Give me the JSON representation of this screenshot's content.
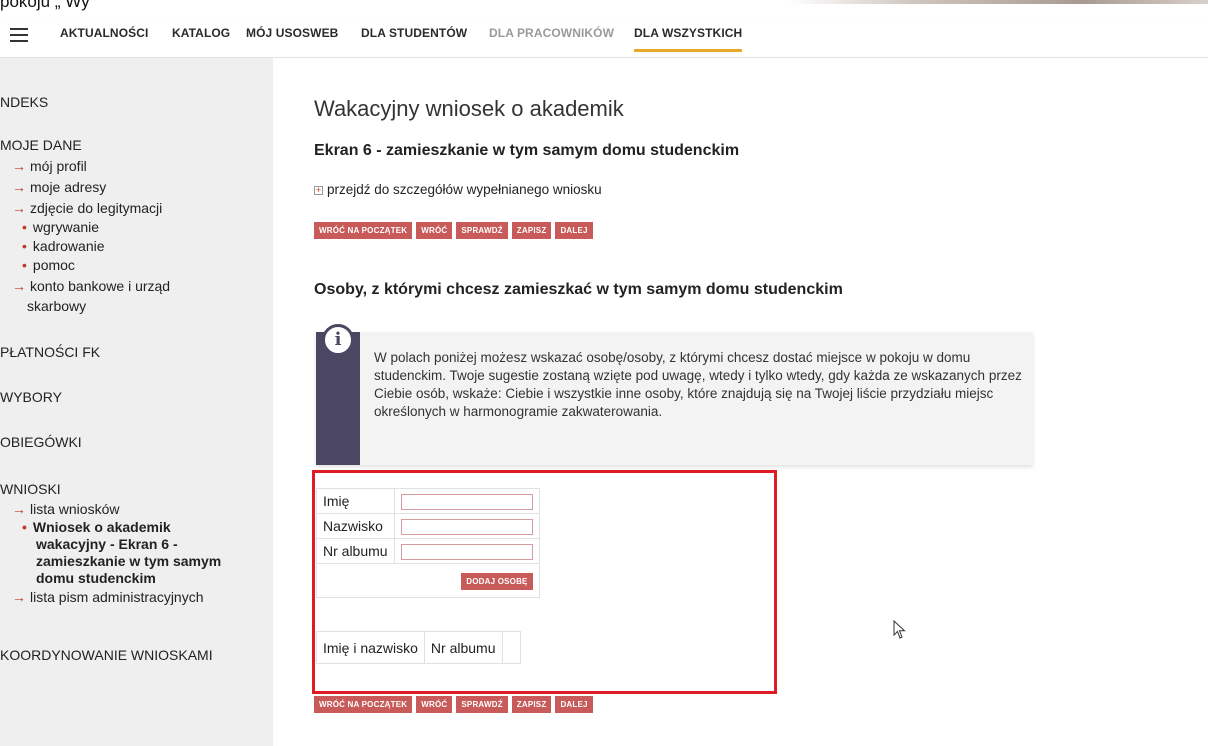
{
  "top_fragment": {
    "text": "pokoju „ Wy"
  },
  "nav": {
    "items": [
      {
        "label": "AKTUALNOŚCI"
      },
      {
        "label": "KATALOG"
      },
      {
        "label": "MÓJ USOSWEB"
      },
      {
        "label": "DLA STUDENTÓW"
      },
      {
        "label": "DLA PRACOWNIKÓW"
      },
      {
        "label": "DLA WSZYSTKICH"
      }
    ]
  },
  "sidebar": {
    "indeks": "NDEKS",
    "moje_dane": "MOJE DANE",
    "moj_profil": "mój profil",
    "moje_adresy": "moje adresy",
    "zdjecie": "zdjęcie do legitymacji",
    "wgrywanie": "wgrywanie",
    "kadrowanie": "kadrowanie",
    "pomoc": "pomoc",
    "konto_l1": "konto bankowe i urząd",
    "konto_l2": "skarbowy",
    "platnosci": "PŁATNOŚCI FK",
    "wybory": "WYBORY",
    "obiegowki": "OBIEGÓWKI",
    "wnioski": "WNIOSKI",
    "lista_wnioskow": "lista wniosków",
    "current_l1": "Wniosek o akademik",
    "current_l2": "wakacyjny - Ekran 6 -",
    "current_l3": "zamieszkanie w tym samym",
    "current_l4": "domu studenckim",
    "lista_pism": "lista pism administracyjnych",
    "koordynowanie": "KOORDYNOWANIE WNIOSKAMI"
  },
  "main": {
    "title": "Wakacyjny wniosek o akademik",
    "subtitle": "Ekran 6 - zamieszkanie w tym samym domu studenckim",
    "details_link": "przejdź do szczegółów wypełnianego wniosku",
    "buttons": {
      "start": "WRÓĆ NA POCZĄTEK",
      "back": "WRÓĆ",
      "check": "SPRAWDŹ",
      "save": "ZAPISZ",
      "next": "DALEJ"
    },
    "section_title": "Osoby, z którymi chcesz zamieszkać w tym samym domu studenckim",
    "info_text": "W polach poniżej możesz wskazać osobę/osoby, z którymi chcesz dostać miejsce w pokoju w domu studenckim. Twoje sugestie zostaną wzięte pod uwagę, wtedy i tylko wtedy, gdy każda ze wskazanych przez Ciebie osób, wskaże: Ciebie i wszystkie inne osoby, które znajdują się na Twojej liście przydziału miejsc określonych w harmonogramie zakwaterowania.",
    "form": {
      "first_name_label": "Imię",
      "first_name_value": "",
      "last_name_label": "Nazwisko",
      "last_name_value": "",
      "album_label": "Nr albumu",
      "album_value": "",
      "add_button": "DODAJ OSOBĘ"
    },
    "list": {
      "col_name": "Imię i nazwisko",
      "col_album": "Nr albumu"
    }
  },
  "colors": {
    "accent_button": "#c85a5a",
    "nav_active_underline": "#e8a927",
    "highlight_frame": "#e01b24",
    "info_bar": "#4b4763"
  },
  "icons": [
    "menu-icon",
    "expand-plus-icon",
    "info-icon",
    "mouse-cursor-icon"
  ]
}
